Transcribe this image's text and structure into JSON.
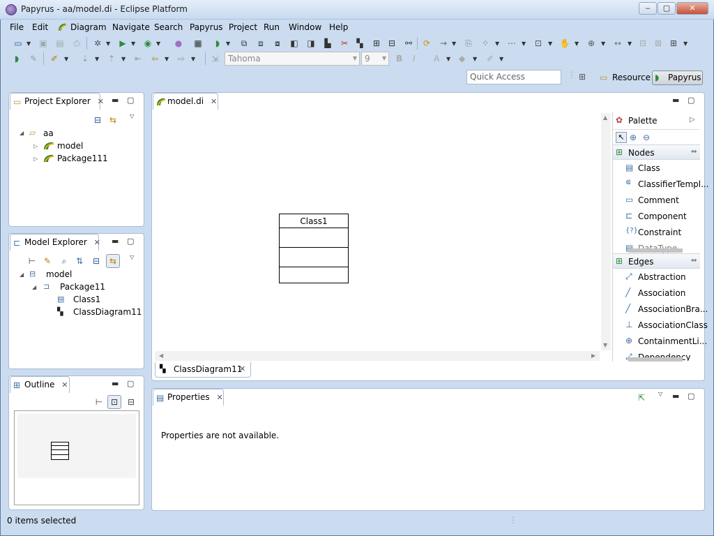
{
  "window": {
    "title": "Papyrus - aa/model.di - Eclipse Platform"
  },
  "menu": [
    "File",
    "Edit",
    "Diagram",
    "Navigate",
    "Search",
    "Papyrus",
    "Project",
    "Run",
    "Window",
    "Help"
  ],
  "toolbar": {
    "font_name": "Tahoma",
    "font_size": "9"
  },
  "quick_access": {
    "placeholder": "Quick Access"
  },
  "perspectives": {
    "resource": "Resource",
    "papyrus": "Papyrus"
  },
  "project_explorer": {
    "title": "Project Explorer",
    "tree": [
      {
        "label": "aa"
      },
      {
        "label": "model"
      },
      {
        "label": "Package111"
      }
    ]
  },
  "model_explorer": {
    "title": "Model Explorer",
    "tree": [
      {
        "label": "model"
      },
      {
        "label": "Package11"
      },
      {
        "label": "Class1"
      },
      {
        "label": "ClassDiagram11"
      }
    ]
  },
  "outline": {
    "title": "Outline"
  },
  "editor": {
    "tab": "model.di",
    "diagram_tab": "ClassDiagram11",
    "class_name": "Class1"
  },
  "palette": {
    "title": "Palette",
    "nodes_title": "Nodes",
    "nodes": [
      "Class",
      "ClassifierTempl...",
      "Comment",
      "Component",
      "Constraint",
      "DataType"
    ],
    "edges_title": "Edges",
    "edges": [
      "Abstraction",
      "Association",
      "AssociationBra...",
      "AssociationClass",
      "ContainmentLi...",
      "Dependency"
    ]
  },
  "properties": {
    "title": "Properties",
    "message": "Properties are not available."
  },
  "status": {
    "text": "0 items selected"
  },
  "colors": {
    "accent": "#3a6ea5",
    "frame": "#cbdcf0",
    "papyrus_green": "#2e8b3a"
  }
}
